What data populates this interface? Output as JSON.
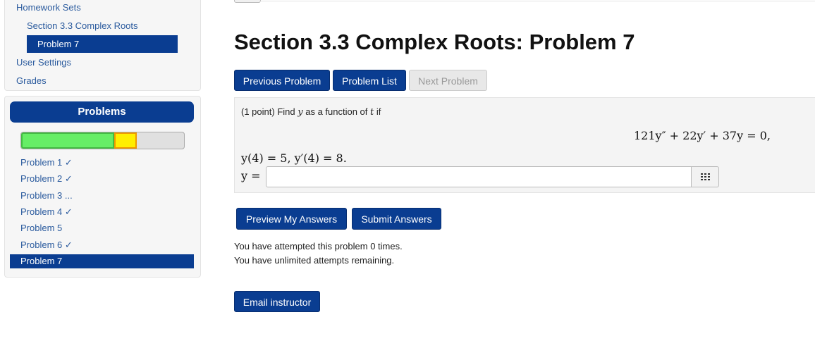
{
  "nav": {
    "homework_sets": "Homework Sets",
    "section": "Section 3.3 Complex Roots",
    "current_problem": "Problem 7",
    "user_settings": "User Settings",
    "grades": "Grades"
  },
  "problems_panel": {
    "title": "Problems",
    "progress": {
      "correct_fraction": 0.57,
      "partial_fraction": 0.14
    },
    "items": [
      {
        "label": "Problem 1 ✓"
      },
      {
        "label": "Problem 2 ✓"
      },
      {
        "label": "Problem 3 ..."
      },
      {
        "label": "Problem 4 ✓"
      },
      {
        "label": "Problem 5"
      },
      {
        "label": "Problem 6 ✓"
      }
    ],
    "active_item": "Problem 7"
  },
  "main": {
    "title": "Section 3.3 Complex Roots: Problem 7",
    "buttons": {
      "previous": "Previous Problem",
      "list": "Problem List",
      "next": "Next Problem",
      "preview": "Preview My Answers",
      "submit": "Submit Answers",
      "email": "Email instructor"
    },
    "problem": {
      "points": "(1 point)",
      "prompt_start": "Find",
      "prompt_var_y": "y",
      "prompt_mid": "as a function of",
      "prompt_var_t": "t",
      "prompt_end": "if",
      "equation": "121y″ + 22y′ + 37y = 0,",
      "initial_conditions": "y(4) = 5,   y′(4) = 8.",
      "answer_label": "y =",
      "answer_value": ""
    },
    "attempts": {
      "line1": "You have attempted this problem 0 times.",
      "line2": "You have unlimited attempts remaining."
    }
  },
  "colors": {
    "primary": "#0a3d91",
    "link": "#2b5b9e",
    "progress_correct": "#66ee66",
    "progress_partial": "#ffee00"
  },
  "icons": {
    "palette": "grid-icon"
  }
}
